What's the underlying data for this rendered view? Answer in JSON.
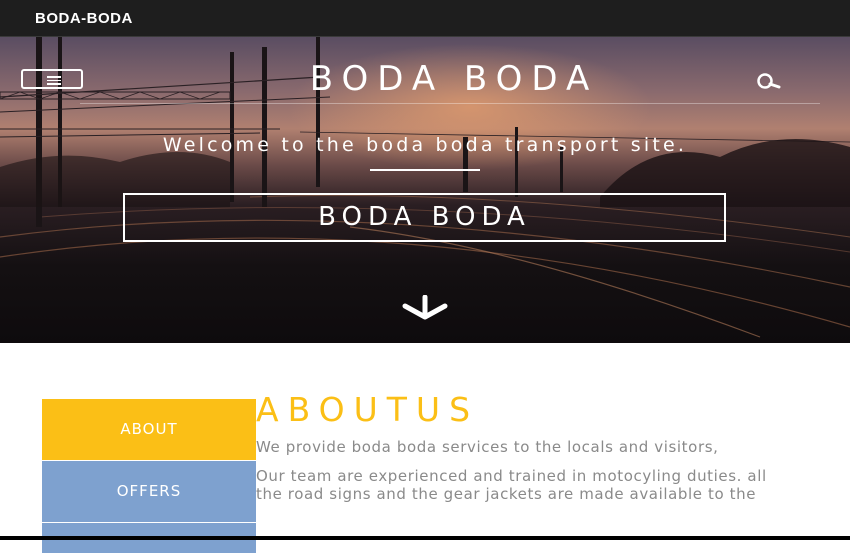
{
  "topbar": {
    "brand": "BODA-BODA"
  },
  "hero": {
    "title": "BODA BODA",
    "welcome": "Welcome to the boda boda transport site.",
    "cta_label": "BODA BODA",
    "menu_icon": "hamburger-icon",
    "search_icon": "search-icon",
    "scroll_icon": "arrow-down-icon"
  },
  "side_nav": {
    "items": [
      {
        "label": "ABOUT"
      },
      {
        "label": "OFFERS"
      },
      {
        "label": ""
      }
    ]
  },
  "about": {
    "title": "ABOUTUS",
    "paragraphs": [
      "We provide boda boda services to the locals and visitors,",
      "Our team are experienced and trained in motocyling duties. all the road signs and the gear jackets are made available to the"
    ]
  },
  "colors": {
    "accent": "#fbbf16",
    "nav_blue": "#7ea1cf",
    "topbar": "#1e1e1e",
    "body_text": "#8a8a8a"
  }
}
